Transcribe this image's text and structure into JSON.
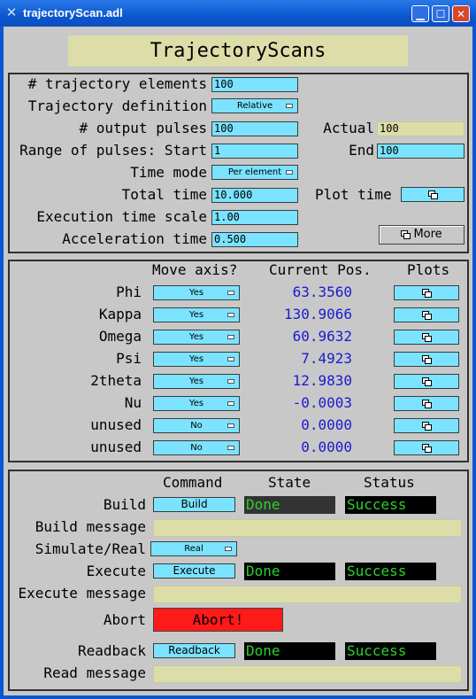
{
  "window": {
    "title": "trajectoryScan.adl"
  },
  "header": {
    "title": "TrajectoryScans"
  },
  "config": {
    "num_elements_label": "# trajectory elements",
    "num_elements": "100",
    "traj_def_label": "Trajectory definition",
    "traj_def": "Relative",
    "num_pulses_label": "# output pulses",
    "num_pulses": "100",
    "actual_label": "Actual",
    "actual": "100",
    "range_label": "Range of pulses: Start",
    "range_start": "1",
    "end_label": "End",
    "range_end": "100",
    "time_mode_label": "Time mode",
    "time_mode": "Per element",
    "total_time_label": "Total time",
    "total_time": "10.000",
    "plot_time_label": "Plot time",
    "exec_scale_label": "Execution time scale",
    "exec_scale": "1.00",
    "accel_label": "Acceleration time",
    "accel": "0.500",
    "more_label": "More"
  },
  "axes": {
    "col_move": "Move axis?",
    "col_pos": "Current Pos.",
    "col_plots": "Plots",
    "rows": [
      {
        "name": "Phi",
        "move": "Yes",
        "pos": "63.3560"
      },
      {
        "name": "Kappa",
        "move": "Yes",
        "pos": "130.9066"
      },
      {
        "name": "Omega",
        "move": "Yes",
        "pos": "60.9632"
      },
      {
        "name": "Psi",
        "move": "Yes",
        "pos": "7.4923"
      },
      {
        "name": "2theta",
        "move": "Yes",
        "pos": "12.9830"
      },
      {
        "name": "Nu",
        "move": "Yes",
        "pos": "-0.0003"
      },
      {
        "name": "unused",
        "move": "No",
        "pos": "0.0000"
      },
      {
        "name": "unused",
        "move": "No",
        "pos": "0.0000"
      }
    ]
  },
  "commands": {
    "col_command": "Command",
    "col_state": "State",
    "col_status": "Status",
    "build_label": "Build",
    "build_button": "Build",
    "build_state": "Done",
    "build_status": "Success",
    "build_msg_label": "Build message",
    "build_msg": "",
    "simreal_label": "Simulate/Real",
    "simreal": "Real",
    "execute_label": "Execute",
    "execute_button": "Execute",
    "execute_state": "Done",
    "execute_status": "Success",
    "execute_msg_label": "Execute message",
    "execute_msg": "",
    "abort_label": "Abort",
    "abort_button": "Abort!",
    "readback_label": "Readback",
    "readback_button": "Readback",
    "readback_state": "Done",
    "readback_status": "Success",
    "read_msg_label": "Read message",
    "read_msg": ""
  },
  "colors": {
    "field": "#7be3ff",
    "title_bg": "#ddddaa",
    "abort": "#ff1a1a",
    "state_text": "#2cd12c",
    "value_text": "#1a1ad0"
  }
}
